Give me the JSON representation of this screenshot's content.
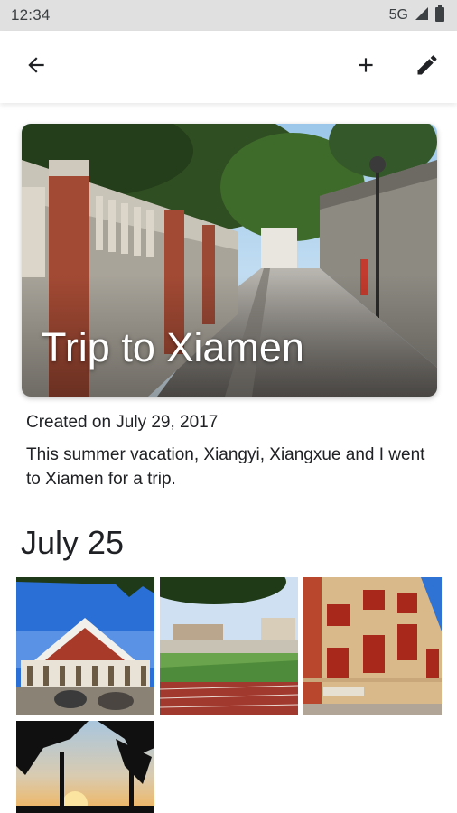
{
  "status_bar": {
    "time": "12:34",
    "network": "5G",
    "icons": [
      "signal-icon",
      "battery-icon"
    ]
  },
  "app_bar": {
    "icons": [
      "back-arrow-icon",
      "add-icon",
      "edit-pencil-icon"
    ]
  },
  "album": {
    "title": "Trip to Xiamen",
    "created": "Created on July 29, 2017",
    "description": "This summer vacation, Xiangyi, Xiangxue and I went to Xiamen for a trip."
  },
  "sections": [
    {
      "date": "July 25",
      "photos": [
        "photo-building-blue-sky",
        "photo-running-track",
        "photo-red-brick-building",
        "photo-palm-sunset"
      ]
    }
  ],
  "colors": {
    "status_bar_bg": "#e0e0e0",
    "background": "#ffffff",
    "text": "#202124"
  }
}
